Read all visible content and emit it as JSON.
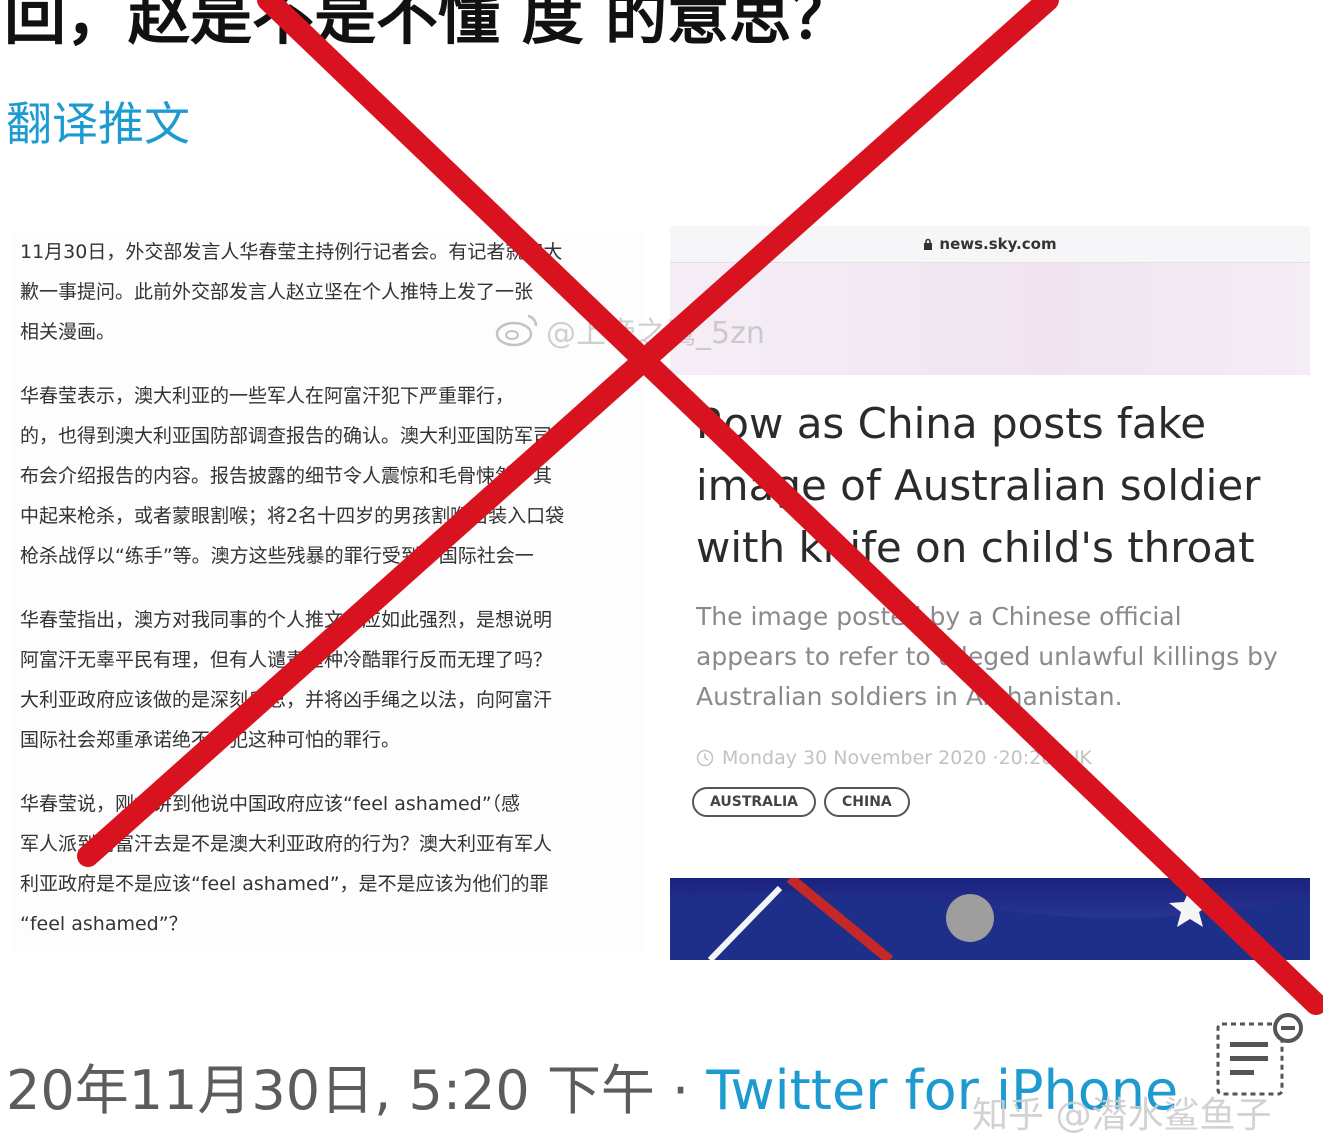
{
  "header": {
    "partial_title": "回，赵是不是不懂 度 的意思？",
    "translate_label": "翻译推文"
  },
  "transcript": {
    "paragraphs": [
      [
        "11月30日，外交部发言人华春莹主持例行记者会。有记者就澳大",
        "歉一事提问。此前外交部发言人赵立坚在个人推特上发了一张",
        "相关漫画。"
      ],
      [
        "华春莹表示，澳大利亚的一些军人在阿富汗犯下严重罪行，",
        "的，也得到澳大利亚国防部调查报告的确认。澳大利亚国防军司",
        "布会介绍报告的内容。报告披露的细节令人震惊和毛骨悚然。其",
        "中起来枪杀，或者蒙眼割喉；将2名十四岁的男孩割喉后装入口袋",
        "枪杀战俘以“练手”等。澳方这些残暴的罪行受到了国际社会一"
      ],
      [
        "华春莹指出，澳方对我同事的个人推文反应如此强烈，是想说明",
        "阿富汗无辜平民有理，但有人谴责这种冷酷罪行反而无理了吗？",
        "大利亚政府应该做的是深刻反思，并将凶手绳之以法，向阿富汗",
        "国际社会郑重承诺绝不再犯这种可怕的罪行。"
      ],
      [
        "华春莹说，刚才讲到他说中国政府应该“feel ashamed”（感",
        "军人派到阿富汗去是不是澳大利亚政府的行为？澳大利亚有军人",
        "利亚政府是不是应该“feel ashamed”，是不是应该为他们的罪",
        "“feel ashamed”？"
      ]
    ]
  },
  "article": {
    "url": "news.sky.com",
    "headline": "Row as China posts fake image of Australian soldier with knife on child's throat",
    "summary": "The image posted by a Chinese official appears to refer to alleged unlawful killings by Australian soldiers in Afghanistan.",
    "dateline": "Monday 30 November 2020 ·20:20, UK",
    "tags": [
      "AUSTRALIA",
      "CHINA"
    ]
  },
  "watermarks": {
    "weibo": "@上帝之鹰_5zn",
    "zhihu": "知乎 @潜水鲨鱼子"
  },
  "meta": {
    "timestamp": "20年11月30日, 5:20 下午 · ",
    "source": "Twitter for iPhone"
  },
  "colors": {
    "link": "#1d9bd1",
    "cross": "#d8131f"
  },
  "icons": [
    "lock-icon",
    "clock-icon",
    "weibo-icon",
    "compose-icon",
    "red-x-mark"
  ]
}
